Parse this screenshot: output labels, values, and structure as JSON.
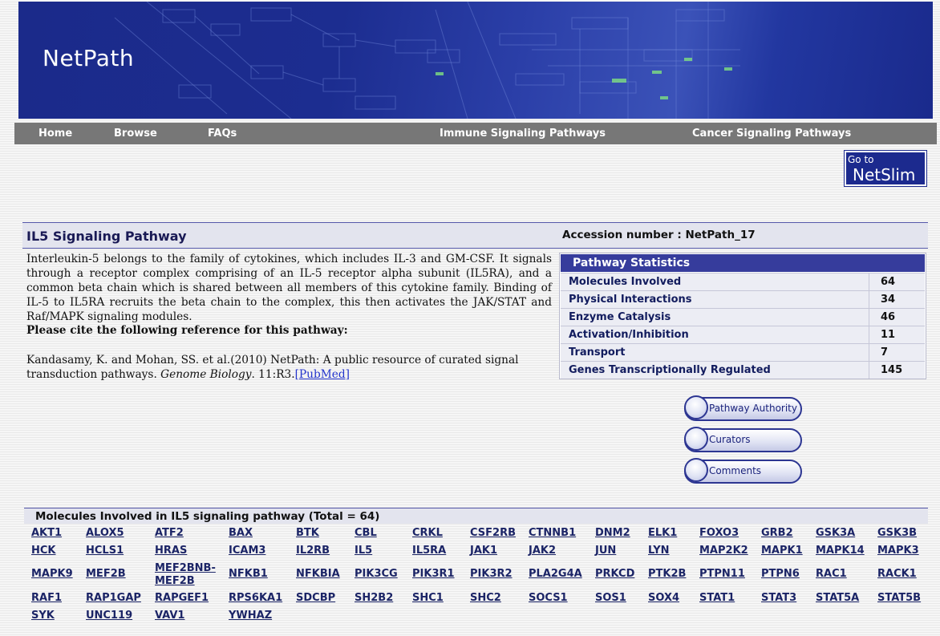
{
  "site": {
    "title": "NetPath"
  },
  "nav": {
    "home": "Home",
    "browse": "Browse",
    "faqs": "FAQs",
    "immune": "Immune Signaling Pathways",
    "cancer": "Cancer Signaling Pathways"
  },
  "netslim": {
    "goto": "Go to",
    "name": "NetSlim"
  },
  "pathway": {
    "title": "IL5 Signaling Pathway",
    "accession": "Accession number : NetPath_17",
    "description": "Interleukin-5 belongs to the family of cytokines, which includes IL-3 and GM-CSF. It signals through a receptor complex comprising of an IL-5 receptor alpha subunit (IL5RA), and a common beta chain which is shared between all members of this cytokine family. Binding of IL-5 to IL5RA recruits the beta chain to the complex, this then activates the JAK/STAT and Raf/MAPK signaling modules.",
    "cite_heading": "Please cite the following reference for this pathway:",
    "cite_text": "Kandasamy, K. and Mohan, SS. et al.(2010) NetPath: A public resource of curated signal transduction pathways.",
    "cite_journal": "Genome Biology",
    "cite_volume": ". 11:R3.",
    "cite_link": "[PubMed]"
  },
  "stats": {
    "title": "Pathway Statistics",
    "rows": [
      {
        "label": "Molecules Involved",
        "value": "64"
      },
      {
        "label": "Physical Interactions",
        "value": "34"
      },
      {
        "label": "Enzyme Catalysis",
        "value": "46"
      },
      {
        "label": "Activation/Inhibition",
        "value": "11"
      },
      {
        "label": "Transport",
        "value": "7"
      },
      {
        "label": "Genes Transcriptionally Regulated",
        "value": "145"
      }
    ]
  },
  "buttons": {
    "authority": "Pathway Authority",
    "curators": "Curators",
    "comments": "Comments"
  },
  "molecules": {
    "heading": "Molecules Involved in IL5 signaling pathway (Total = 64)",
    "rows": [
      [
        "AKT1",
        "ALOX5",
        "ATF2",
        "BAX",
        "BTK",
        "CBL",
        "CRKL",
        "CSF2RB",
        "CTNNB1",
        "DNM2",
        "ELK1",
        "FOXO3",
        "GRB2",
        "GSK3A",
        "GSK3B"
      ],
      [
        "HCK",
        "HCLS1",
        "HRAS",
        "ICAM3",
        "IL2RB",
        "IL5",
        "IL5RA",
        "JAK1",
        "JAK2",
        "JUN",
        "LYN",
        "MAP2K2",
        "MAPK1",
        "MAPK14",
        "MAPK3"
      ],
      [
        "MAPK9",
        "MEF2B",
        "MEF2BNB-MEF2B",
        "NFKB1",
        "NFKBIA",
        "PIK3CG",
        "PIK3R1",
        "PIK3R2",
        "PLA2G4A",
        "PRKCD",
        "PTK2B",
        "PTPN11",
        "PTPN6",
        "RAC1",
        "RACK1"
      ],
      [
        "RAF1",
        "RAP1GAP",
        "RAPGEF1",
        "RPS6KA1",
        "SDCBP",
        "SH2B2",
        "SHC1",
        "SHC2",
        "SOCS1",
        "SOS1",
        "SOX4",
        "STAT1",
        "STAT3",
        "STAT5A",
        "STAT5B"
      ],
      [
        "SYK",
        "UNC119",
        "VAV1",
        "YWHAZ"
      ]
    ]
  },
  "colors": {
    "banner": "#1c2d90",
    "nav": "#777777",
    "stats_header": "#363c9c",
    "section_bg": "#e3e4ee"
  }
}
